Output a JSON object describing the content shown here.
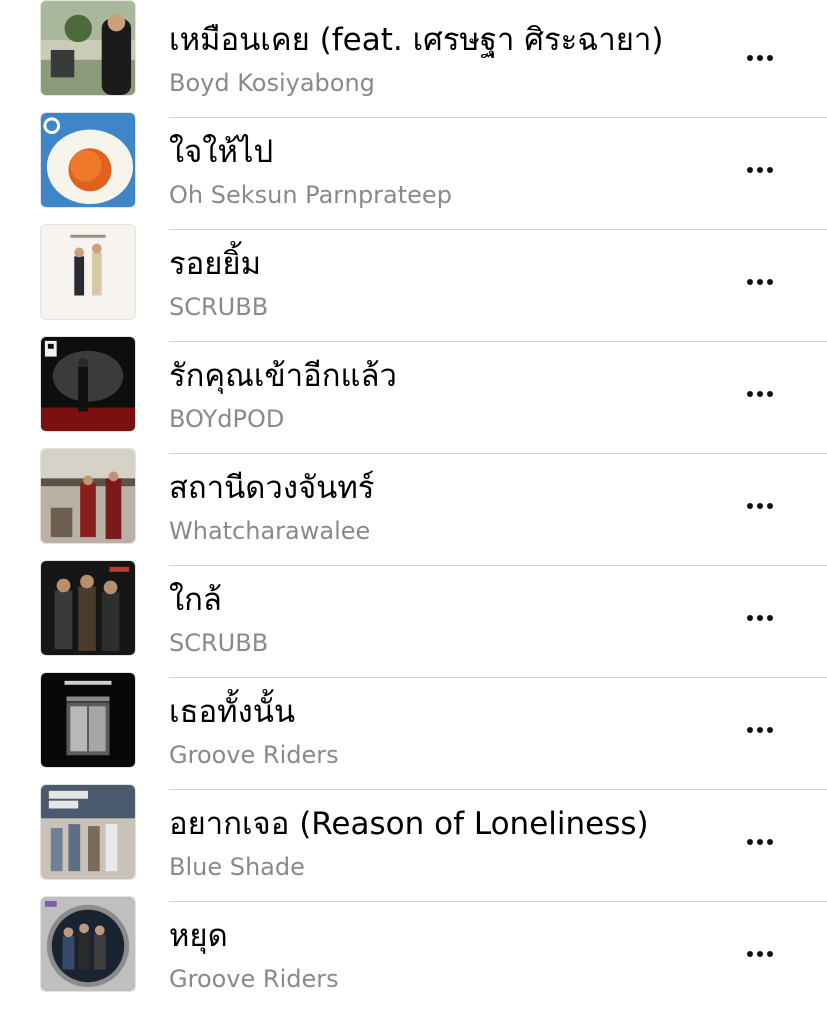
{
  "songs": [
    {
      "title": "เหมือนเคย (feat. เศรษฐา ศิระฉายา)",
      "artist": "Boyd Kosiyabong",
      "artwork": "album-art-boyd"
    },
    {
      "title": "ใจให้ไป",
      "artist": "Oh Seksun Parnprateep",
      "artwork": "album-art-fried-egg"
    },
    {
      "title": "รอยยิ้ม",
      "artist": "SCRUBB",
      "artwork": "album-art-scrubb-white"
    },
    {
      "title": "รักคุณเข้าอีกแล้ว",
      "artist": "BOYdPOD",
      "artwork": "album-art-boydpod"
    },
    {
      "title": "สถานีดวงจันทร์",
      "artist": "Whatcharawalee",
      "artwork": "album-art-station"
    },
    {
      "title": "ใกล้",
      "artist": "SCRUBB",
      "artwork": "album-art-scrubb-dark"
    },
    {
      "title": "เธอทั้งนั้น",
      "artist": "Groove Riders",
      "artwork": "album-art-groove-elevator"
    },
    {
      "title": "อยากเจอ (Reason of Loneliness)",
      "artist": "Blue Shade",
      "artwork": "album-art-blue-shade"
    },
    {
      "title": "หยุด",
      "artist": "Groove Riders",
      "artwork": "album-art-groove-circle"
    }
  ],
  "more_icon": "ellipsis-icon",
  "colors": {
    "title": "#000000",
    "artist": "#8a8a8e",
    "separator": "#d1d1d6"
  }
}
